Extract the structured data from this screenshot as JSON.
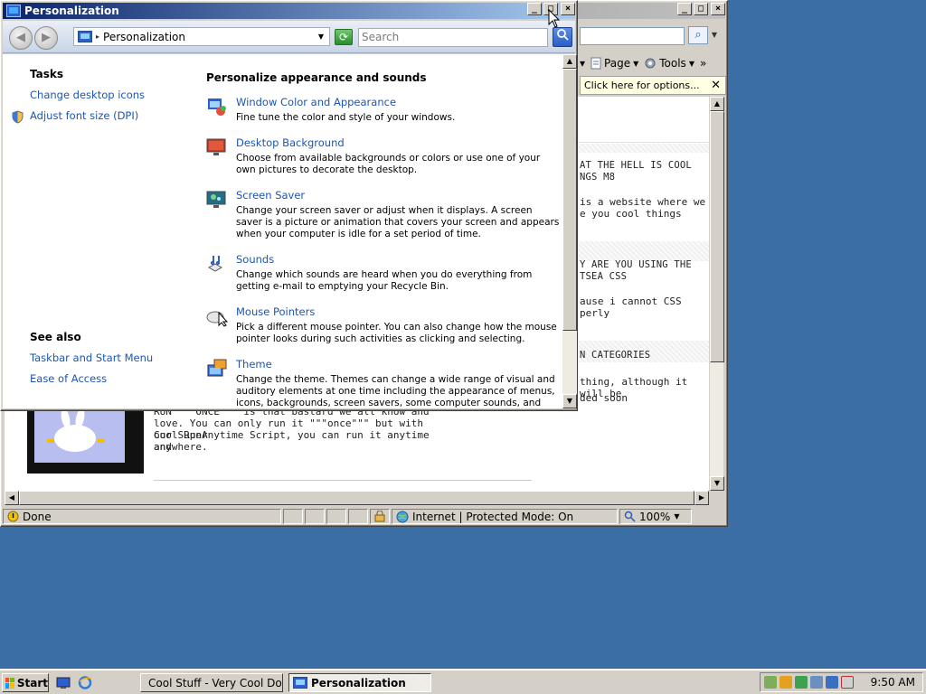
{
  "ie_window": {
    "title": "Cool Stuff - Very Cool Do...",
    "search_button": "⌕",
    "commands": [
      {
        "label": "Page",
        "icon": "page-icon"
      },
      {
        "label": "Tools",
        "icon": "gear-icon"
      }
    ],
    "overflow": "»",
    "infobar_text": "Click here for options...",
    "status": {
      "text": "Done",
      "zone": "Internet | Protected Mode: On",
      "zoom": "100%"
    },
    "page": {
      "sections": [
        {
          "title_line1": "AT THE HELL IS COOL",
          "title_line2": "NGS M8",
          "body_line1": "is a website where we",
          "body_line2": "e you cool things"
        },
        {
          "title_line1": "Y ARE YOU USING THE",
          "title_line2": "TSEA CSS",
          "body_line1": "ause i cannot CSS",
          "body_line2": "perly"
        },
        {
          "title_line1": "N CATEGORIES",
          "title_line2": "",
          "body_line1": "thing, although it will be",
          "body_line2": "ded soon"
        }
      ],
      "article_lines": [
        "RUN  \"\"\"ONCE\"\"\"  is that bastard we all know and",
        "love. You can only run it \"\"\"once\"\"\" but with our Super",
        "Cool RunAnytime Script, you can run it anytime and",
        "anywhere."
      ]
    }
  },
  "pers_window": {
    "title": "Personalization",
    "breadcrumb": "Personalization",
    "search_placeholder": "Search",
    "tasks_heading": "Tasks",
    "tasks": [
      "Change desktop icons",
      "Adjust font size (DPI)"
    ],
    "see_also_heading": "See also",
    "see_also": [
      "Taskbar and Start Menu",
      "Ease of Access"
    ],
    "main_heading": "Personalize appearance and sounds",
    "items": [
      {
        "title": "Window Color and Appearance",
        "desc": "Fine tune the color and style of your windows.",
        "icon": "window-color-icon"
      },
      {
        "title": "Desktop Background",
        "desc": "Choose from available backgrounds or colors or use one of your own pictures to decorate the desktop.",
        "icon": "desktop-background-icon"
      },
      {
        "title": "Screen Saver",
        "desc": "Change your screen saver or adjust when it displays. A screen saver is a picture or animation that covers your screen and appears when your computer is idle for a set period of time.",
        "icon": "screen-saver-icon"
      },
      {
        "title": "Sounds",
        "desc": "Change which sounds are heard when you do everything from getting e-mail to emptying your Recycle Bin.",
        "icon": "sounds-icon"
      },
      {
        "title": "Mouse Pointers",
        "desc": "Pick a different mouse pointer. You can also change how the mouse pointer looks during such activities as clicking and selecting.",
        "icon": "mouse-pointers-icon"
      },
      {
        "title": "Theme",
        "desc": "Change the theme. Themes can change a wide range of visual and auditory elements at one time including the appearance of menus, icons, backgrounds, screen savers, some computer sounds, and mouse",
        "icon": "theme-icon"
      }
    ]
  },
  "taskbar": {
    "start_label": "Start",
    "tasks": [
      {
        "label": "Cool Stuff - Very Cool Do...",
        "icon": "ie-icon",
        "pressed": false
      },
      {
        "label": "Personalization",
        "icon": "control-panel-icon",
        "pressed": true
      }
    ],
    "clock": "9:50 AM"
  },
  "colors": {
    "desktop": "#3a6ea5",
    "link": "#1c55b5",
    "title_active": "#0a246a"
  }
}
